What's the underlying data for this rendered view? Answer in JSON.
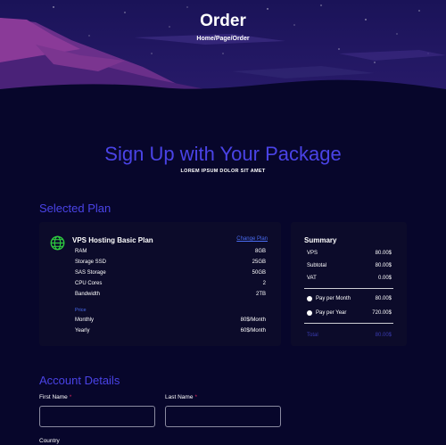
{
  "hero": {
    "title": "Order",
    "breadcrumb": {
      "home": "Home",
      "sep1": "/",
      "page": "Page",
      "sep2": "/",
      "current": "Order"
    }
  },
  "intro": {
    "title": "Sign Up with Your Package",
    "subtitle": "LOREM IPSUM DOLOR SIT AMET"
  },
  "selected_plan": {
    "heading": "Selected Plan",
    "icon": "globe-icon",
    "plan_name": "VPS Hosting Basic Plan",
    "change_link": "Change Plan",
    "specs": [
      {
        "label": "RAM",
        "value": "8GB"
      },
      {
        "label": "Storage SSD",
        "value": "25GB"
      },
      {
        "label": "SAS Storage",
        "value": "50GB"
      },
      {
        "label": "CPU Cores",
        "value": "2"
      },
      {
        "label": "Bandwidth",
        "value": "2TB"
      }
    ],
    "price_label": "Price",
    "prices": [
      {
        "label": "Monthly",
        "value": "80$/Month"
      },
      {
        "label": "Yearly",
        "value": "60$/Month"
      }
    ]
  },
  "summary": {
    "title": "Summary",
    "rows": [
      {
        "label": "VPS",
        "value": "80.00$"
      },
      {
        "label": "Subtotal",
        "value": "80.00$"
      },
      {
        "label": "VAT",
        "value": "0.00$"
      }
    ],
    "options": [
      {
        "label": "Pay per Month",
        "value": "80.00$"
      },
      {
        "label": "Pay per Year",
        "value": "720.00$"
      }
    ],
    "total_label": "Total",
    "total_value": "80.00$"
  },
  "account": {
    "heading": "Account Details",
    "first_name_label": "First Name",
    "last_name_label": "Last Name",
    "required_mark": "*",
    "country_label": "Country"
  },
  "colors": {
    "background": "#07062b",
    "accent": "#4a43e6",
    "card": "#0c0b2a",
    "link": "#4a6cf0",
    "required": "#e0245e",
    "globe": "#2ecc40"
  }
}
